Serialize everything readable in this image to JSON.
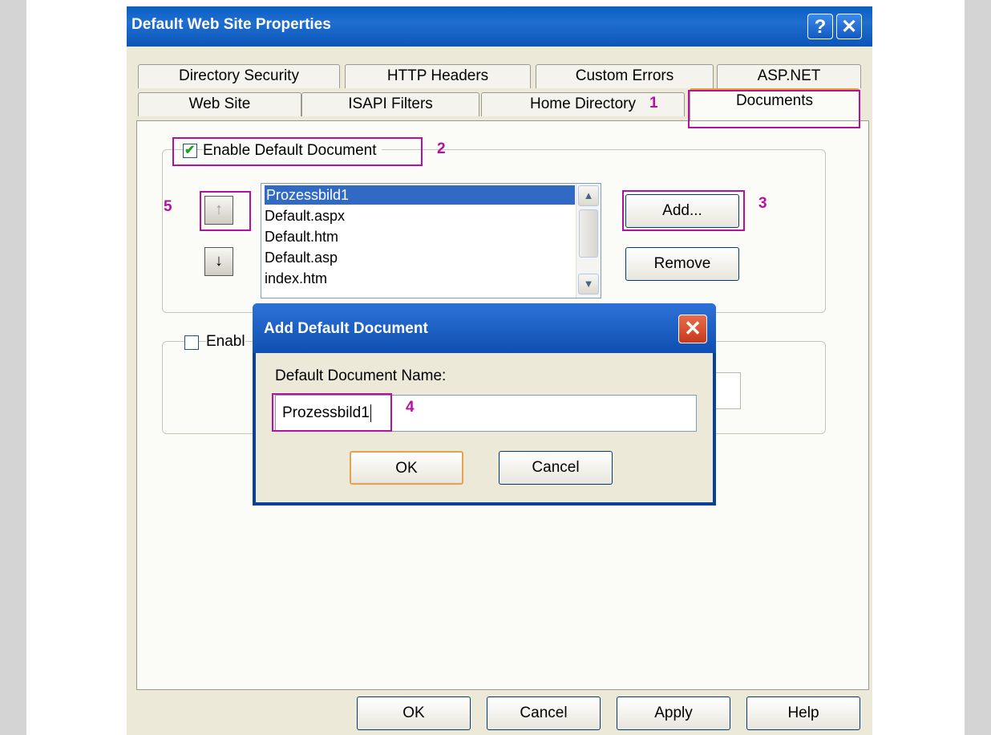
{
  "window": {
    "title": "Default Web Site Properties",
    "help_glyph": "?",
    "close_glyph": "✕"
  },
  "tabs_row1": [
    "Directory Security",
    "HTTP Headers",
    "Custom Errors",
    "ASP.NET"
  ],
  "tabs_row2": [
    "Web Site",
    "ISAPI Filters",
    "Home Directory",
    "Documents"
  ],
  "enable_default_document": {
    "label": "Enable Default Document",
    "checked": true
  },
  "documents": [
    "Prozessbild1",
    "Default.aspx",
    "Default.htm",
    "Default.asp",
    "index.htm"
  ],
  "move_up_glyph": "↑",
  "move_down_glyph": "↓",
  "add_button": "Add...",
  "remove_button": "Remove",
  "enable_footer": {
    "label": "Enabl",
    "checked": false
  },
  "dialog": {
    "title": "Add Default Document",
    "field_label": "Default Document Name:",
    "field_value": "Prozessbild1",
    "ok": "OK",
    "cancel": "Cancel",
    "close_glyph": "✕"
  },
  "footer_buttons": {
    "ok": "OK",
    "cancel": "Cancel",
    "apply": "Apply",
    "help": "Help"
  },
  "annotations": [
    "1",
    "2",
    "3",
    "4",
    "5"
  ],
  "colors": {
    "annotation": "#b5119f",
    "titlebar": "#0a5fc0",
    "selection": "#316ac5"
  }
}
